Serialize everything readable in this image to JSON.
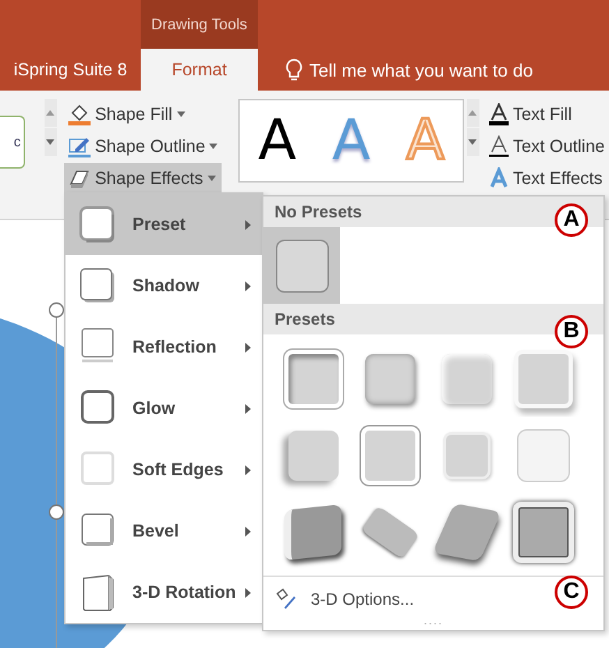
{
  "title_bar": {
    "context_label": "Drawing Tools"
  },
  "tabs": [
    {
      "label": "iSpring Suite 8",
      "selected": false
    },
    {
      "label": "Format",
      "selected": true
    }
  ],
  "tell_me": {
    "placeholder": "Tell me what you want to do"
  },
  "ribbon": {
    "style_gallery_text": "c",
    "shape_buttons": [
      {
        "label": "Shape Fill",
        "kind": "fill",
        "expanded": false
      },
      {
        "label": "Shape Outline",
        "kind": "outline",
        "expanded": false
      },
      {
        "label": "Shape Effects",
        "kind": "effects",
        "expanded": true
      }
    ],
    "wordart": [
      {
        "label": "A",
        "kind": "black"
      },
      {
        "label": "A",
        "kind": "blue"
      },
      {
        "label": "A",
        "kind": "orange"
      }
    ],
    "text_buttons": [
      {
        "label": "Text Fill",
        "kind": "fill"
      },
      {
        "label": "Text Outline",
        "kind": "outline"
      },
      {
        "label": "Text Effects",
        "kind": "effects"
      }
    ]
  },
  "effects_menu": [
    {
      "label": "Preset",
      "kind": "preset",
      "selected": true
    },
    {
      "label": "Shadow",
      "kind": "shadow",
      "selected": false
    },
    {
      "label": "Reflection",
      "kind": "reflection",
      "selected": false
    },
    {
      "label": "Glow",
      "kind": "glow",
      "selected": false
    },
    {
      "label": "Soft Edges",
      "kind": "soft",
      "selected": false
    },
    {
      "label": "Bevel",
      "kind": "bevel",
      "selected": false
    },
    {
      "label": "3-D Rotation",
      "kind": "rotation",
      "selected": false
    }
  ],
  "preset_panel": {
    "sections": [
      {
        "heading": "No Presets",
        "tiles": [
          {
            "selected": true
          }
        ]
      },
      {
        "heading": "Presets",
        "tiles": [
          {
            "selected": false
          },
          {
            "selected": false
          },
          {
            "selected": false
          },
          {
            "selected": false
          },
          {
            "selected": false
          },
          {
            "selected": false
          },
          {
            "selected": false
          },
          {
            "selected": false
          },
          {
            "selected": false
          },
          {
            "selected": false
          },
          {
            "selected": false
          },
          {
            "selected": false
          }
        ]
      }
    ],
    "options_label": "3-D Options...",
    "grip": "...."
  },
  "markers": [
    "A",
    "B",
    "C"
  ]
}
